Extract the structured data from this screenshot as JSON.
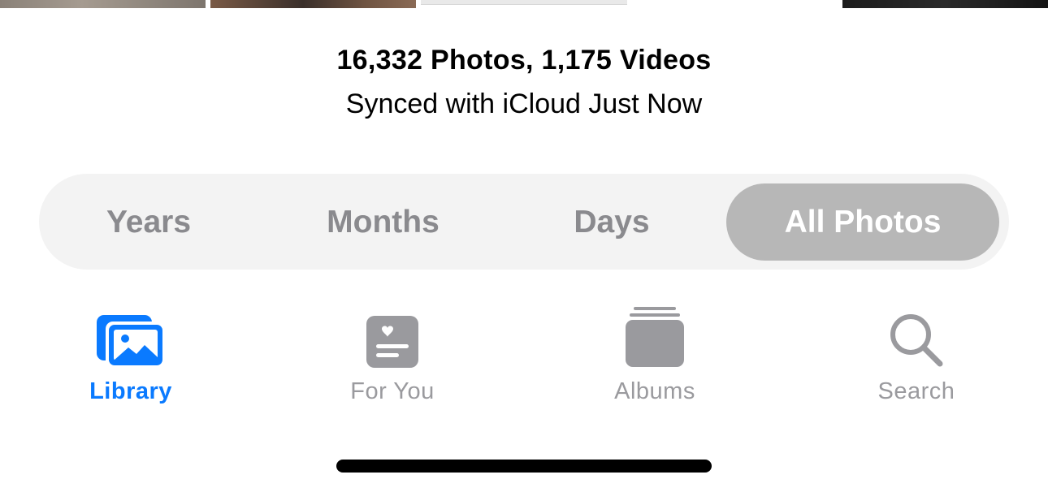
{
  "summary": {
    "counts": "16,332 Photos, 1,175 Videos",
    "sync_status": "Synced with iCloud Just Now"
  },
  "view_selector": {
    "options": [
      {
        "label": "Years",
        "selected": false
      },
      {
        "label": "Months",
        "selected": false
      },
      {
        "label": "Days",
        "selected": false
      },
      {
        "label": "All Photos",
        "selected": true
      }
    ]
  },
  "tab_bar": {
    "tabs": [
      {
        "label": "Library",
        "icon": "photo-stack-icon",
        "active": true
      },
      {
        "label": "For You",
        "icon": "memories-heart-icon",
        "active": false
      },
      {
        "label": "Albums",
        "icon": "albums-stack-icon",
        "active": false
      },
      {
        "label": "Search",
        "icon": "magnifying-glass-icon",
        "active": false
      }
    ]
  },
  "colors": {
    "accent": "#0a7aff",
    "inactive": "#9a9a9e",
    "segment_background": "#f3f3f3",
    "segment_selected": "#b7b7b7"
  }
}
